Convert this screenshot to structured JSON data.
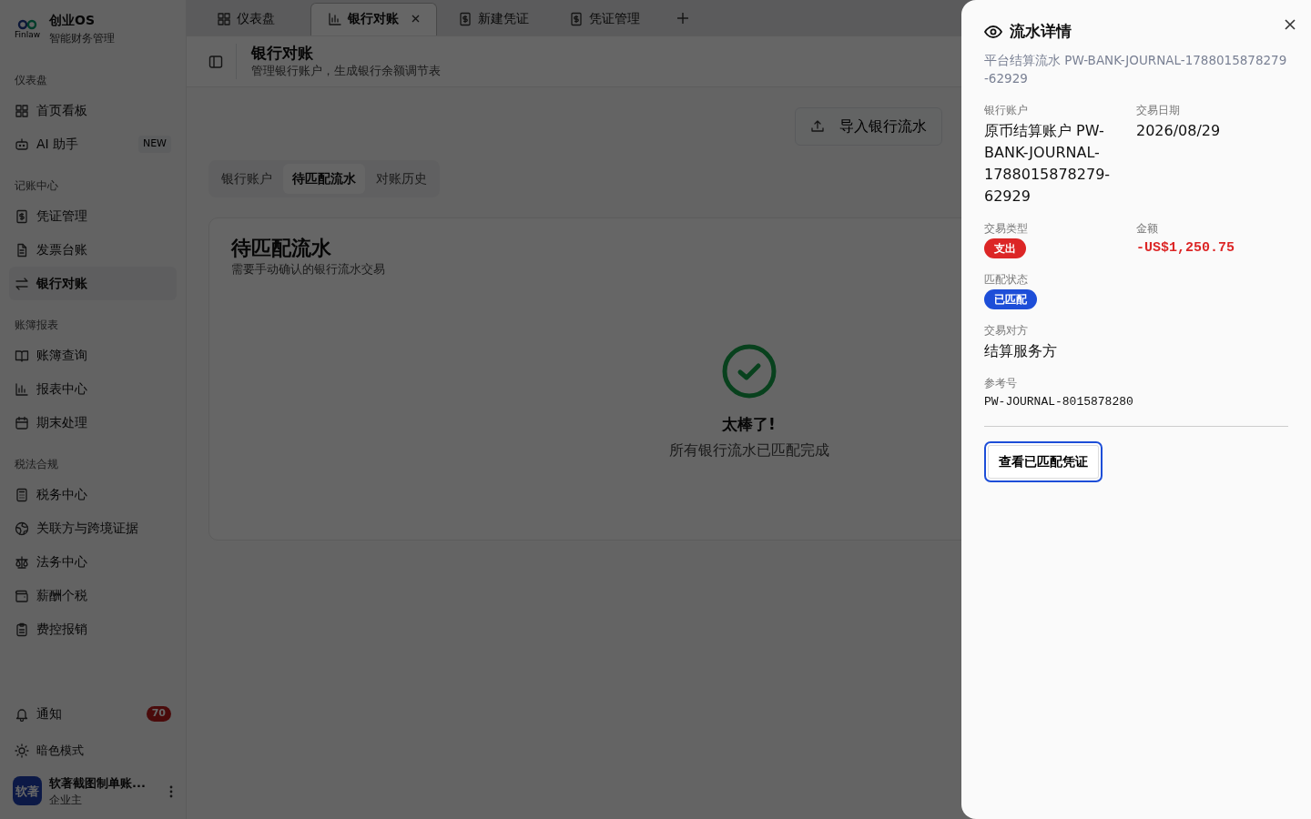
{
  "brand": {
    "logo_text": "Finlaw",
    "name": "创业OS",
    "subtitle": "智能财务管理"
  },
  "sidebar": {
    "sections": [
      {
        "title": "仪表盘",
        "items": [
          {
            "label": "首页看板",
            "selected": false
          },
          {
            "label": "AI 助手",
            "selected": false,
            "badge": "NEW"
          }
        ]
      },
      {
        "title": "记账中心",
        "items": [
          {
            "label": "凭证管理",
            "selected": false
          },
          {
            "label": "发票台账",
            "selected": false
          },
          {
            "label": "银行对账",
            "selected": true
          }
        ]
      },
      {
        "title": "账簿报表",
        "items": [
          {
            "label": "账簿查询",
            "selected": false
          },
          {
            "label": "报表中心",
            "selected": false
          },
          {
            "label": "期末处理",
            "selected": false
          }
        ]
      },
      {
        "title": "税法合规",
        "items": [
          {
            "label": "税务中心",
            "selected": false
          },
          {
            "label": "关联方与跨境证据",
            "selected": false
          },
          {
            "label": "法务中心",
            "selected": false
          },
          {
            "label": "薪酬个税",
            "selected": false
          },
          {
            "label": "费控报销",
            "selected": false
          }
        ]
      }
    ],
    "notifications": {
      "label": "通知",
      "count": "70"
    },
    "theme_toggle": "暗色模式",
    "user": {
      "avatar": "软著",
      "name": "软著截图制单账...",
      "role": "企业主"
    }
  },
  "tabs": [
    {
      "label": "仪表盘",
      "selected": false,
      "closable": false
    },
    {
      "label": "银行对账",
      "selected": true,
      "closable": true
    },
    {
      "label": "新建凭证",
      "selected": false,
      "closable": false
    },
    {
      "label": "凭证管理",
      "selected": false,
      "closable": false
    }
  ],
  "page": {
    "title": "银行对账",
    "subtitle": "管理银行账户，生成银行余额调节表",
    "import_button": "导入银行流水",
    "subtabs": [
      {
        "label": "银行账户",
        "selected": false
      },
      {
        "label": "待匹配流水",
        "selected": true
      },
      {
        "label": "对账历史",
        "selected": false
      }
    ],
    "card": {
      "title": "待匹配流水",
      "subtitle": "需要手动确认的银行流水交易",
      "empty_title": "太棒了!",
      "empty_message": "所有银行流水已匹配完成"
    }
  },
  "drawer": {
    "title": "流水详情",
    "subtitle": "平台结算流水 PW-BANK-JOURNAL-1788015878279-62929",
    "fields": [
      {
        "label": "银行账户",
        "kind": "text",
        "value": "原币结算账户 PW-BANK-JOURNAL-1788015878279-62929"
      },
      {
        "label": "交易日期",
        "kind": "text",
        "value": "2026/08/29"
      },
      {
        "label": "交易类型",
        "kind": "badge",
        "value": "支出",
        "color": "#dc2626"
      },
      {
        "label": "金额",
        "kind": "amount",
        "value": "-US$1,250.75"
      },
      {
        "label": "匹配状态",
        "kind": "badge",
        "value": "已匹配",
        "color": "#1d4ed8"
      },
      {
        "label": "交易对方",
        "kind": "text",
        "value": "结算服务方"
      },
      {
        "label": "参考号",
        "kind": "mono",
        "value": "PW-JOURNAL-8015878280"
      }
    ],
    "button": "查看已匹配凭证"
  }
}
